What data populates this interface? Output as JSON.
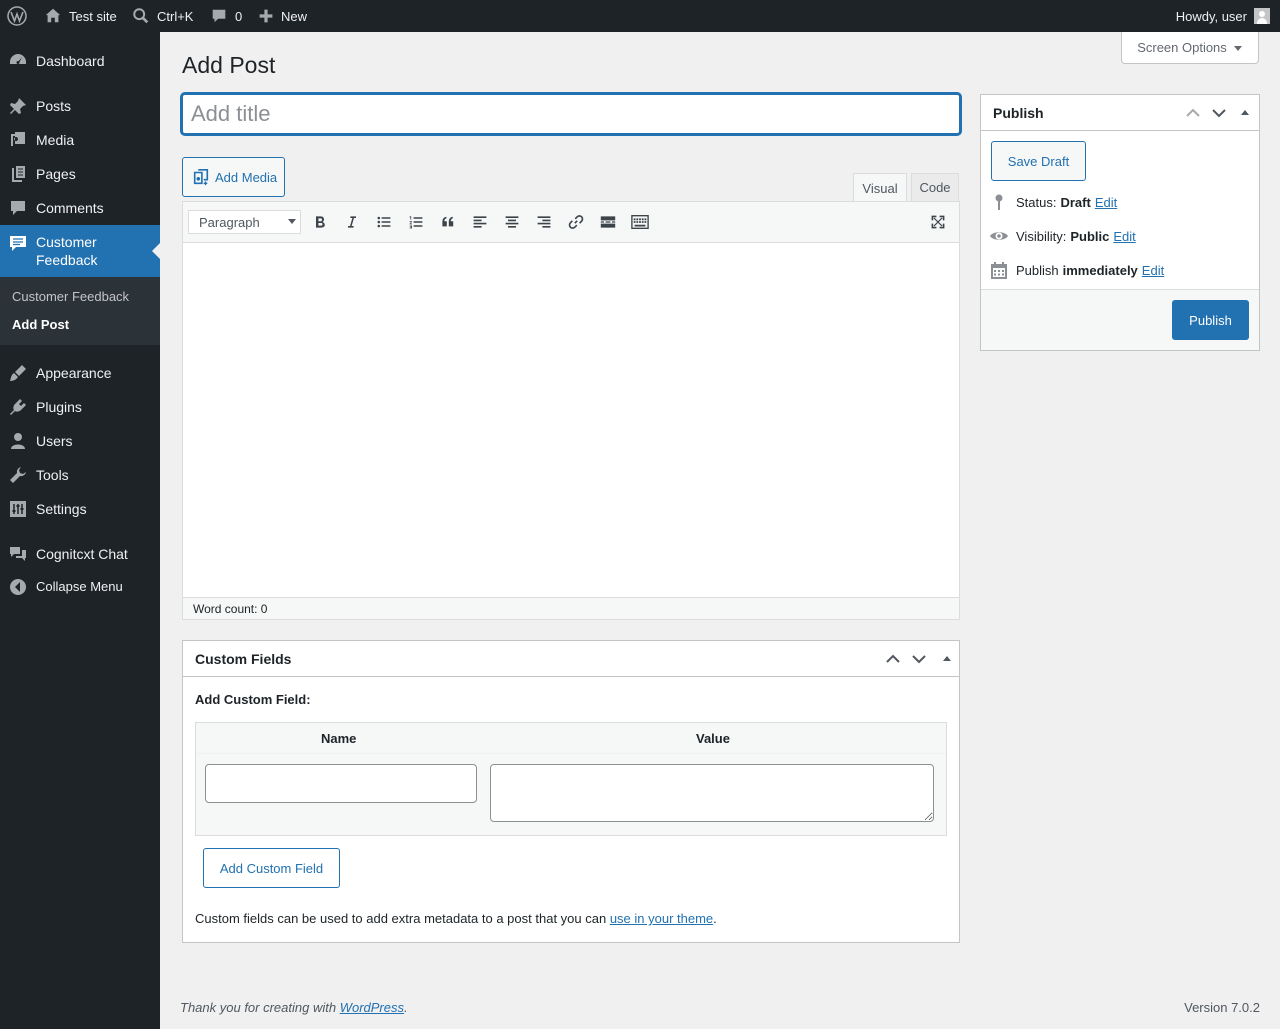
{
  "admin_bar": {
    "site_name": "Test site",
    "search_shortcut": "Ctrl+K",
    "comments_count": "0",
    "new_label": "New",
    "howdy": "Howdy, user"
  },
  "sidebar": {
    "items": [
      {
        "label": "Dashboard",
        "icon": "dashboard-icon"
      },
      {
        "label": "Posts",
        "icon": "pin-icon"
      },
      {
        "label": "Media",
        "icon": "media-icon"
      },
      {
        "label": "Pages",
        "icon": "pages-icon"
      },
      {
        "label": "Comments",
        "icon": "comments-icon"
      },
      {
        "label": "Customer\nFeedback",
        "icon": "feedback-icon"
      },
      {
        "label": "Appearance",
        "icon": "brush-icon"
      },
      {
        "label": "Plugins",
        "icon": "plugin-icon"
      },
      {
        "label": "Users",
        "icon": "users-icon"
      },
      {
        "label": "Tools",
        "icon": "wrench-icon"
      },
      {
        "label": "Settings",
        "icon": "sliders-icon"
      },
      {
        "label": "Cognitcxt Chat",
        "icon": "chat-icon"
      },
      {
        "label": "Collapse Menu",
        "icon": "collapse-icon"
      }
    ],
    "submenu": [
      "Customer Feedback",
      "Add Post"
    ]
  },
  "screen_options": "Screen Options",
  "page_title": "Add Post",
  "title_placeholder": "Add title",
  "add_media": "Add Media",
  "editor": {
    "tab_visual": "Visual",
    "tab_code": "Code",
    "format": "Paragraph",
    "word_count": "Word count: 0"
  },
  "publish": {
    "title": "Publish",
    "save_draft": "Save Draft",
    "status_label": "Status:",
    "status_value": "Draft",
    "visibility_label": "Visibility:",
    "visibility_value": "Public",
    "schedule_label": "Publish",
    "schedule_value": "immediately",
    "edit": "Edit",
    "publish_button": "Publish"
  },
  "custom_fields": {
    "title": "Custom Fields",
    "add_label": "Add Custom Field:",
    "col_name": "Name",
    "col_value": "Value",
    "add_button": "Add Custom Field",
    "desc_prefix": "Custom fields can be used to add extra metadata to a post that you can ",
    "desc_link": "use in your theme",
    "desc_suffix": "."
  },
  "footer": {
    "thanks_prefix": "Thank you for creating with ",
    "thanks_link": "WordPress",
    "thanks_suffix": ".",
    "version": "Version 7.0.2"
  },
  "colors": {
    "accent": "#2271b1",
    "adminbar": "#1d2327",
    "background": "#f0f0f1"
  }
}
